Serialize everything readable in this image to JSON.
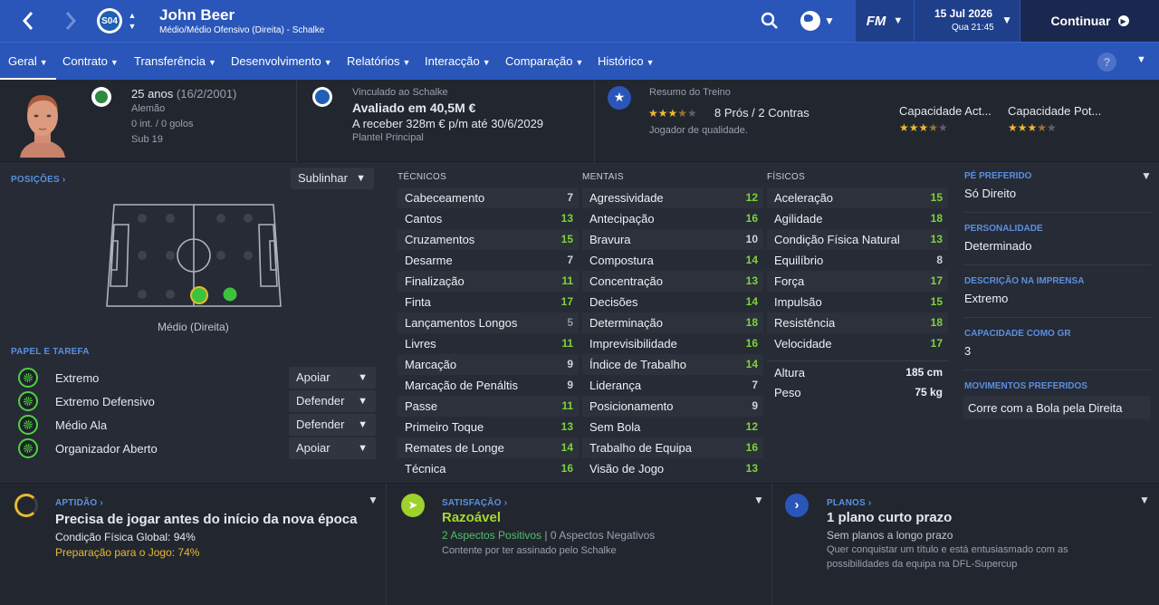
{
  "topbar": {
    "club_abbrev": "S04",
    "player_name": "John Beer",
    "player_subtitle": "Médio/Médio Ofensivo (Direita) - Schalke",
    "fm_label": "FM",
    "date": "15 Jul 2026",
    "day_time": "Qua 21:45",
    "continue_label": "Continuar",
    "icons": [
      "back-arrow-icon",
      "forward-arrow-icon",
      "search-icon",
      "globe-icon",
      "chevron-down-icon",
      "play-icon"
    ]
  },
  "subnav": {
    "tabs": [
      {
        "label": "Geral",
        "active": true
      },
      {
        "label": "Contrato",
        "active": false
      },
      {
        "label": "Transferência",
        "active": false
      },
      {
        "label": "Desenvolvimento",
        "active": false
      },
      {
        "label": "Relatórios",
        "active": false
      },
      {
        "label": "Interacção",
        "active": false
      },
      {
        "label": "Comparação",
        "active": false
      },
      {
        "label": "Histórico",
        "active": false
      }
    ],
    "help_label": "?"
  },
  "header": {
    "age": "25 anos",
    "birth": "(16/2/2001)",
    "nationality": "Alemão",
    "caps": "0 int. / 0 golos",
    "youth": "Sub 19",
    "contract_title": "Vinculado ao Schalke",
    "value": "Avaliado em 40,5M €",
    "wage": "A receber 328m € p/m até 30/6/2029",
    "squad": "Plantel Principal",
    "training_title": "Resumo do Treino",
    "training_rating": 3.5,
    "pros_cons": "8 Prós / 2 Contras",
    "quality": "Jogador de qualidade.",
    "current_ability_label": "Capacidade Act...",
    "current_ability_stars": 3.5,
    "potential_ability_label": "Capacidade Pot...",
    "potential_ability_stars": 3.5
  },
  "positions": {
    "title": "POSIÇÕES",
    "highlight_label": "Sublinhar",
    "position_caption": "Médio (Direita)"
  },
  "roles": {
    "title": "PAPEL E TAREFA",
    "items": [
      {
        "role": "Extremo",
        "duty": "Apoiar"
      },
      {
        "role": "Extremo Defensivo",
        "duty": "Defender"
      },
      {
        "role": "Médio Ala",
        "duty": "Defender"
      },
      {
        "role": "Organizador Aberto",
        "duty": "Apoiar"
      }
    ]
  },
  "attributes": {
    "technical_title": "TÉCNICOS",
    "mental_title": "MENTAIS",
    "physical_title": "FÍSICOS",
    "technical": [
      {
        "name": "Cabeceamento",
        "value": 7
      },
      {
        "name": "Cantos",
        "value": 13
      },
      {
        "name": "Cruzamentos",
        "value": 15
      },
      {
        "name": "Desarme",
        "value": 7
      },
      {
        "name": "Finalização",
        "value": 11
      },
      {
        "name": "Finta",
        "value": 17
      },
      {
        "name": "Lançamentos Longos",
        "value": 5
      },
      {
        "name": "Livres",
        "value": 11
      },
      {
        "name": "Marcação",
        "value": 9
      },
      {
        "name": "Marcação de Penáltis",
        "value": 9
      },
      {
        "name": "Passe",
        "value": 11
      },
      {
        "name": "Primeiro Toque",
        "value": 13
      },
      {
        "name": "Remates de Longe",
        "value": 14
      },
      {
        "name": "Técnica",
        "value": 16
      }
    ],
    "mental": [
      {
        "name": "Agressividade",
        "value": 12
      },
      {
        "name": "Antecipação",
        "value": 16
      },
      {
        "name": "Bravura",
        "value": 10
      },
      {
        "name": "Compostura",
        "value": 14
      },
      {
        "name": "Concentração",
        "value": 13
      },
      {
        "name": "Decisões",
        "value": 14
      },
      {
        "name": "Determinação",
        "value": 18
      },
      {
        "name": "Imprevisibilidade",
        "value": 16
      },
      {
        "name": "Índice de Trabalho",
        "value": 14
      },
      {
        "name": "Liderança",
        "value": 7
      },
      {
        "name": "Posicionamento",
        "value": 9
      },
      {
        "name": "Sem Bola",
        "value": 12
      },
      {
        "name": "Trabalho de Equipa",
        "value": 16
      },
      {
        "name": "Visão de Jogo",
        "value": 13
      }
    ],
    "physical": [
      {
        "name": "Aceleração",
        "value": 15
      },
      {
        "name": "Agilidade",
        "value": 18
      },
      {
        "name": "Condição Física Natural",
        "value": 13
      },
      {
        "name": "Equilíbrio",
        "value": 8
      },
      {
        "name": "Força",
        "value": 17
      },
      {
        "name": "Impulsão",
        "value": 15
      },
      {
        "name": "Resistência",
        "value": 18
      },
      {
        "name": "Velocidade",
        "value": 17
      }
    ],
    "height_label": "Altura",
    "height_value": "185 cm",
    "weight_label": "Peso",
    "weight_value": "75 kg"
  },
  "right": {
    "foot_title": "PÉ PREFERIDO",
    "foot_value": "Só Direito",
    "personality_title": "PERSONALIDADE",
    "personality_value": "Determinado",
    "media_title": "DESCRIÇÃO NA IMPRENSA",
    "media_value": "Extremo",
    "gk_title": "CAPACIDADE COMO GR",
    "gk_value": "3",
    "moves_title": "MOVIMENTOS PREFERIDOS",
    "moves_value": "Corre com a Bola pela Direita"
  },
  "bottom": {
    "fitness_title": "APTIDÃO",
    "fitness_headline": "Precisa de jogar antes do início da nova época",
    "fitness_line1": "Condição Física Global: 94%",
    "fitness_line2": "Preparação para o Jogo: 74%",
    "satisfaction_title": "SATISFAÇÃO",
    "satisfaction_value": "Razoável",
    "satisfaction_positive": "2 Aspectos Positivos",
    "satisfaction_sep": "|",
    "satisfaction_negative": "0 Aspectos Negativos",
    "satisfaction_note": "Contente por ter assinado pelo Schalke",
    "plans_title": "PLANOS",
    "plans_headline": "1 plano curto prazo",
    "plans_sub": "Sem planos a longo prazo",
    "plans_note1": "Quer conquistar um título e está entusiasmado com as",
    "plans_note2": "possibilidades da equipa na DFL-Supercup"
  },
  "colors": {
    "accent": "#2a56b9",
    "high_attr": "#7ed33a",
    "link_blue": "#5b8fe0",
    "star": "#f2b92f"
  }
}
